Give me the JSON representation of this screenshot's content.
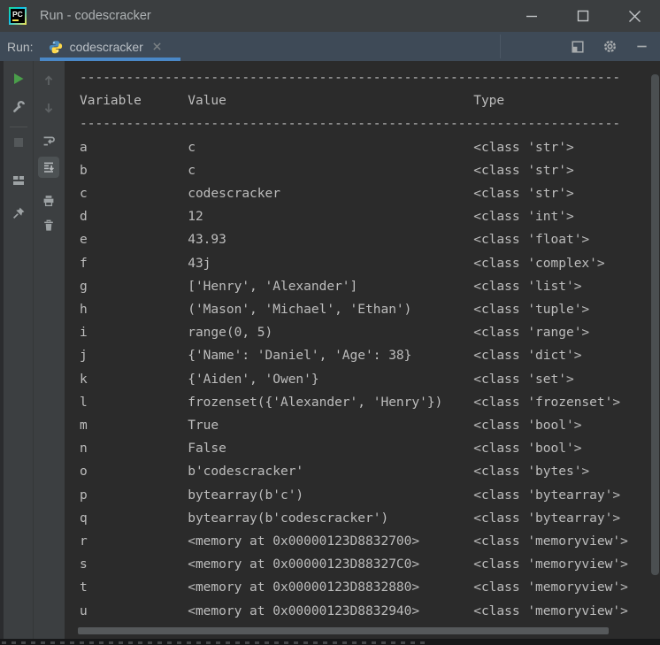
{
  "window": {
    "title": "Run - codescracker",
    "app_badge": "PC"
  },
  "tabbar": {
    "run_label": "Run:",
    "tab_label": "codescracker"
  },
  "console": {
    "separator": "----------------------------------------------------------------------",
    "columns": [
      "Variable",
      "Value",
      "Type"
    ],
    "rows": [
      [
        "a",
        "c",
        "<class 'str'>"
      ],
      [
        "b",
        "c",
        "<class 'str'>"
      ],
      [
        "c",
        "codescracker",
        "<class 'str'>"
      ],
      [
        "d",
        "12",
        "<class 'int'>"
      ],
      [
        "e",
        "43.93",
        "<class 'float'>"
      ],
      [
        "f",
        "43j",
        "<class 'complex'>"
      ],
      [
        "g",
        "['Henry', 'Alexander']",
        "<class 'list'>"
      ],
      [
        "h",
        "('Mason', 'Michael', 'Ethan')",
        "<class 'tuple'>"
      ],
      [
        "i",
        "range(0, 5)",
        "<class 'range'>"
      ],
      [
        "j",
        "{'Name': 'Daniel', 'Age': 38}",
        "<class 'dict'>"
      ],
      [
        "k",
        "{'Aiden', 'Owen'}",
        "<class 'set'>"
      ],
      [
        "l",
        "frozenset({'Alexander', 'Henry'})",
        "<class 'frozenset'>"
      ],
      [
        "m",
        "True",
        "<class 'bool'>"
      ],
      [
        "n",
        "False",
        "<class 'bool'>"
      ],
      [
        "o",
        "b'codescracker'",
        "<class 'bytes'>"
      ],
      [
        "p",
        "bytearray(b'c')",
        "<class 'bytearray'>"
      ],
      [
        "q",
        "bytearray(b'codescracker')",
        "<class 'bytearray'>"
      ],
      [
        "r",
        "<memory at 0x00000123D8832700>",
        "<class 'memoryview'>"
      ],
      [
        "s",
        "<memory at 0x00000123D88327C0>",
        "<class 'memoryview'>"
      ],
      [
        "t",
        "<memory at 0x00000123D8832880>",
        "<class 'memoryview'>"
      ],
      [
        "u",
        "<memory at 0x00000123D8832940>",
        "<class 'memoryview'>"
      ]
    ]
  },
  "colors": {
    "accent_blue": "#4a88c7",
    "run_green": "#4a9e4a",
    "console_bg": "#2b2b2b",
    "panel_bg": "#3c3f41",
    "tabbar_bg": "#3e4a57",
    "titlebar_bg": "#3b3e40",
    "console_text": "#bdbdbd"
  }
}
